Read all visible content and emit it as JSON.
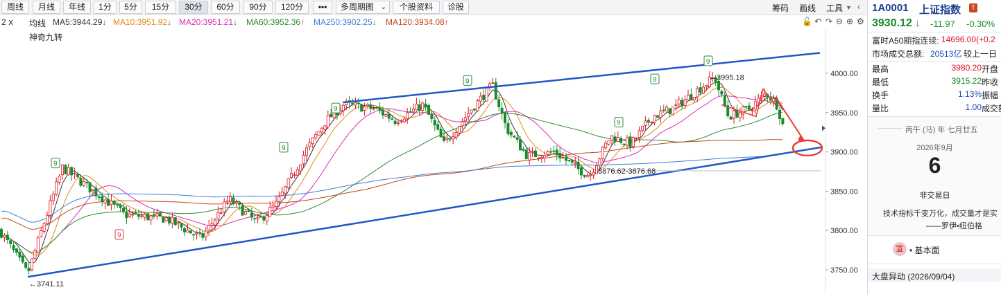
{
  "toolbar": {
    "periods": [
      "周线",
      "月线",
      "年线",
      "1分",
      "5分",
      "15分",
      "30分",
      "60分",
      "90分",
      "120分"
    ],
    "selected": "30分",
    "more": "•••",
    "multi_period": "多周期图",
    "stock_info": "个股资料",
    "diagnose": "诊股",
    "chips": "筹码",
    "draw": "画线",
    "tools": "工具"
  },
  "ma_legend": {
    "prefix": "2 ⅹ",
    "label": "均线",
    "items": [
      {
        "text": "MA5:3944.29",
        "arrow": "↓",
        "color": "#333333",
        "arrow_color": "#1a8a2b"
      },
      {
        "text": "MA10:3951.92",
        "arrow": "↓",
        "color": "#e08a17",
        "arrow_color": "#1a8a2b"
      },
      {
        "text": "MA20:3951.21",
        "arrow": "↓",
        "color": "#d92bb4",
        "arrow_color": "#1a8a2b"
      },
      {
        "text": "MA60:3952.36",
        "arrow": "↑",
        "color": "#2c8a2c",
        "arrow_color": "#e0101f"
      },
      {
        "text": "MA250:3902.25",
        "arrow": "↓",
        "color": "#3b7fd4",
        "arrow_color": "#1a8a2b"
      },
      {
        "text": "MA120:3934.08",
        "arrow": "↑",
        "color": "#c2461a",
        "arrow_color": "#e0101f"
      }
    ]
  },
  "indicator_name": "神奇九转",
  "chart_data": {
    "type": "candlestick",
    "y_ticks": [
      "4000.00",
      "3950.00",
      "3900.00",
      "3850.00",
      "3800.00",
      "3750.00"
    ],
    "ylim": [
      3735,
      4055
    ],
    "annotations": {
      "low": "←3741.11",
      "high": "←3995.18",
      "mid_low": "3876.62-3876.68"
    },
    "nine_marks": [
      "9",
      "9",
      "9",
      "9",
      "9",
      "9",
      "9",
      "9"
    ],
    "last_price": 3930.12,
    "trend_upper": [
      [
        3963,
        4026
      ]
    ],
    "trend_lower": [
      [
        3741,
        3906
      ]
    ],
    "colors": {
      "up": "#e0101f",
      "down": "#1a8a2b",
      "trendline": "#1f57c9"
    }
  },
  "panel": {
    "code": "1A0001",
    "name": "上证指数",
    "price": "3930.12",
    "arrow": "↓",
    "change": "-11.97",
    "pct": "-0.30%",
    "a50_label": "富时A50期指连续:",
    "a50_value": "14696.00(+0.2",
    "turnover_label": "市场成交总额:",
    "turnover_value": "20513亿",
    "turnover_cmp": "较上一日",
    "high_label": "最高",
    "high_value": "3980.20",
    "open_label": "开盘",
    "low_label": "最低",
    "low_value": "3915.22",
    "prev_label": "昨收",
    "turnover_rate_label": "换手",
    "turnover_rate_value": "1.13%",
    "amplitude_label": "振幅",
    "vol_ratio_label": "量比",
    "vol_ratio_value": "1.00",
    "volume_label": "成交额",
    "lunar": "丙午 (马) 年 七月廿五",
    "month": "2026年9月",
    "day": "6",
    "nontrade": "非交易日",
    "quote1": "技术指标千变万化，成交量才是实",
    "quote2": "——罗伊•纽伯格",
    "fundamentals_badge": "宣",
    "fundamentals": "• 基本面",
    "market_move": "大盘异动 (2026/09/04)"
  }
}
